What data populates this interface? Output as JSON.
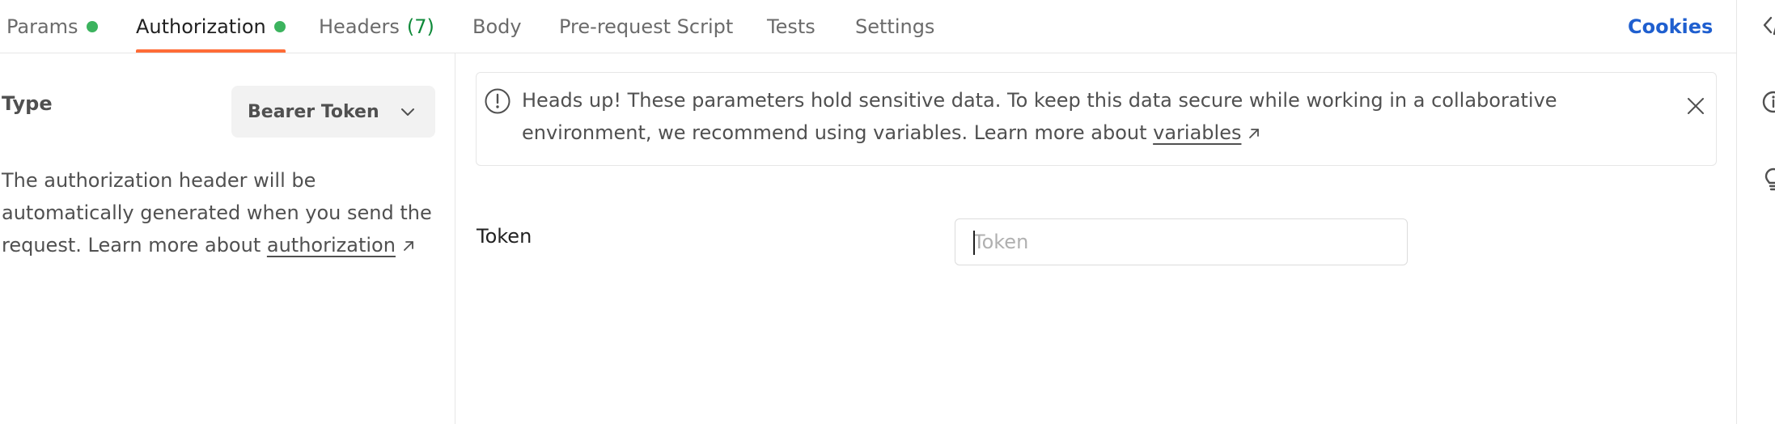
{
  "tabs": [
    {
      "label": "Params",
      "dot": true
    },
    {
      "label": "Authorization",
      "dot": true,
      "active": true
    },
    {
      "label": "Headers",
      "count": "(7)"
    },
    {
      "label": "Body"
    },
    {
      "label": "Pre-request Script"
    },
    {
      "label": "Tests"
    },
    {
      "label": "Settings"
    }
  ],
  "cookies_label": "Cookies",
  "auth": {
    "type_label": "Type",
    "type_value": "Bearer Token",
    "desc_prefix": "The authorization header will be automatically generated when you send the request. Learn more about",
    "desc_link": "authorization"
  },
  "alert": {
    "text": "Heads up! These parameters hold sensitive data. To keep this data secure while working in a collaborative environment, we recommend using variables. Learn more about",
    "link": "variables"
  },
  "token": {
    "label": "Token",
    "placeholder": "Token",
    "value": ""
  },
  "colors": {
    "accent": "#ff6c37",
    "status_dot": "#3cb35e",
    "count": "#0f8a3a",
    "link": "#1f5fcf"
  },
  "icons": {
    "alert": "exclamation-circle-icon",
    "close": "close-icon",
    "chevron": "chevron-down-icon",
    "external": "external-link-arrow-icon",
    "strip": [
      "code-icon",
      "info-icon",
      "lightbulb-icon"
    ]
  }
}
